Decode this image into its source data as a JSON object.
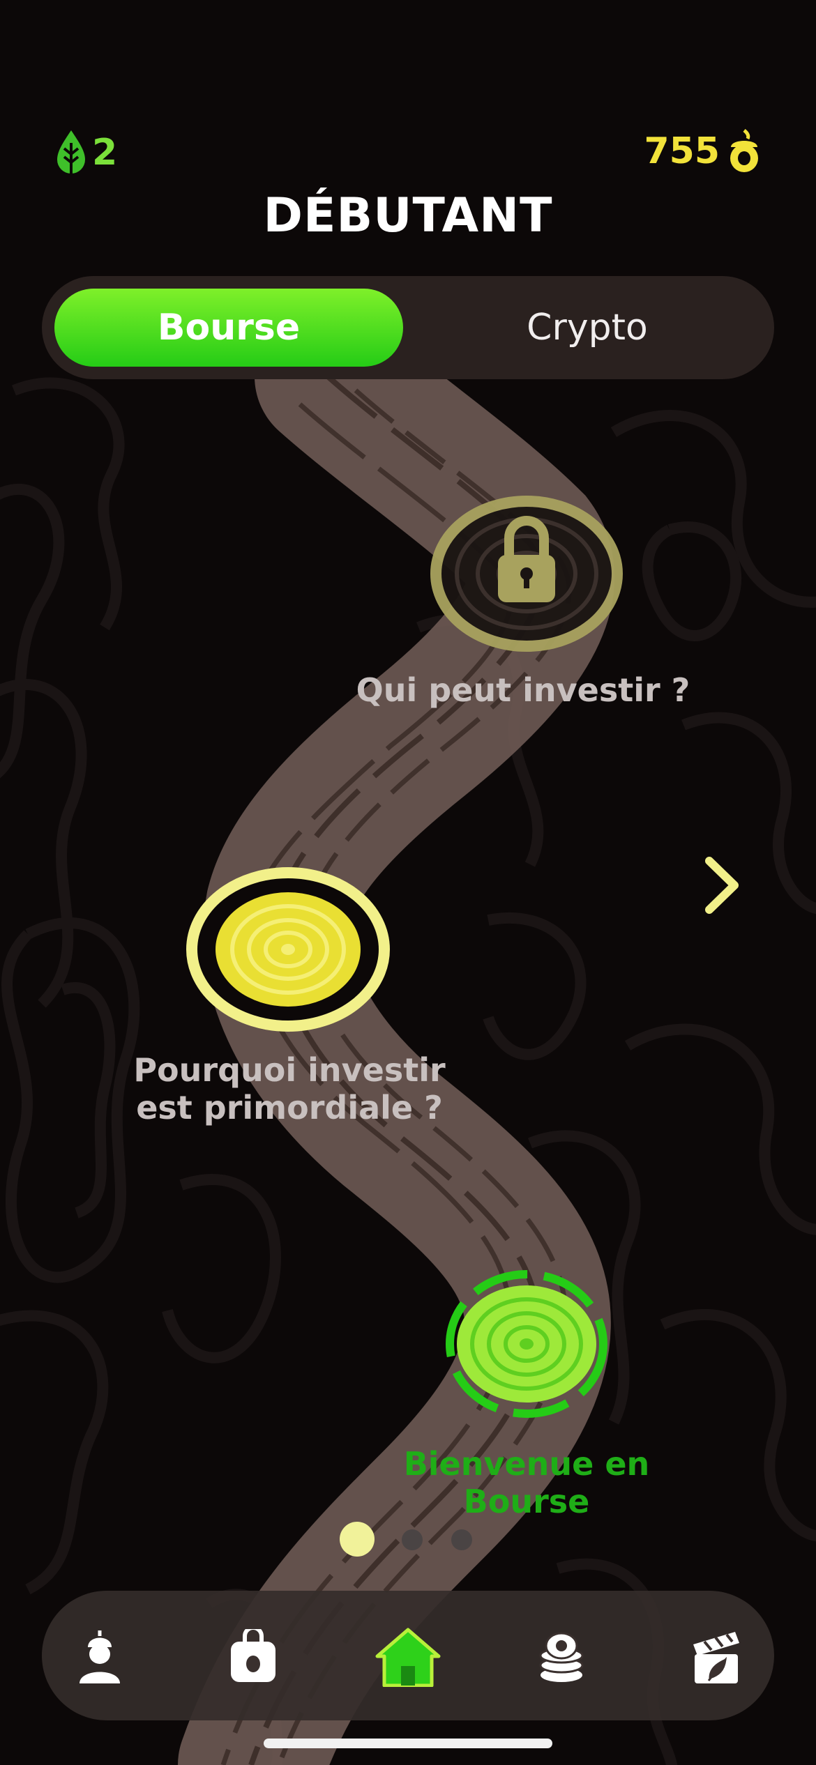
{
  "header": {
    "lives_count": "2",
    "coins_count": "755",
    "level_title": "DÉBUTANT",
    "lives_icon": "leaf-drop-icon",
    "coins_icon": "acorn-coin-icon"
  },
  "segmented": {
    "options": [
      "Bourse",
      "Crypto"
    ],
    "selected": "Bourse"
  },
  "path": {
    "nodes": [
      {
        "label": "Qui peut investir ?",
        "state": "locked"
      },
      {
        "label_line1": "Pourquoi investir",
        "label_line2": "est primordiale ?",
        "state": "available"
      },
      {
        "label_line1": "Bienvenue en",
        "label_line2": "Bourse",
        "state": "in-progress"
      }
    ]
  },
  "pagination": {
    "current": 1,
    "total": 3
  },
  "tabbar": {
    "items": [
      "profile-icon",
      "backpack-icon",
      "home-icon",
      "coins-stack-icon",
      "clapperboard-icon"
    ],
    "active": "home-icon"
  },
  "colors": {
    "accent_green": "#2ed11a",
    "lime": "#b8f03a",
    "yellow": "#f2e23a",
    "background": "#0c0808",
    "trunk": "#7a6660"
  }
}
